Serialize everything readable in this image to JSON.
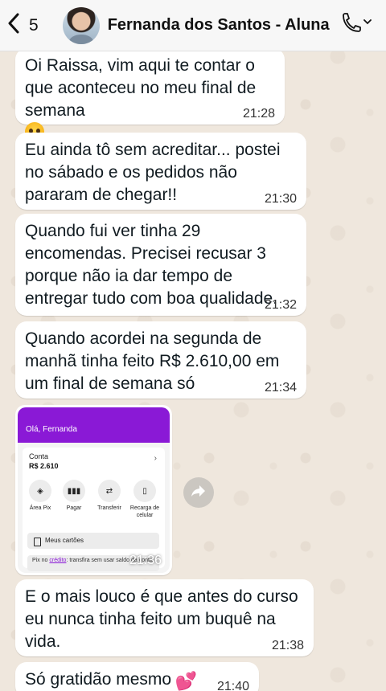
{
  "header": {
    "back_count": "5",
    "contact_name": "Fernanda dos Santos - Aluna"
  },
  "messages": [
    {
      "text": "Oi Raissa, vim aqui te contar o que aconteceu no meu final de semana",
      "emoji": "pleading-face",
      "time": "21:28"
    },
    {
      "text": "Eu ainda tô sem acreditar... postei no sábado e os pedidos não pararam de chegar!!",
      "time": "21:30"
    },
    {
      "text": "Quando fui ver tinha 29 encomendas. Precisei recusar 3 porque não ia dar tempo de entregar tudo com boa qualidade.",
      "time": "21:32"
    },
    {
      "text": "Quando acordei na segunda de manhã tinha feito R$ 2.610,00 em um final de semana só",
      "time": "21:34"
    },
    {
      "text": "E o mais louco é que antes do curso eu nunca tinha feito um buquê na vida.",
      "time": "21:38"
    },
    {
      "text": "Só gratidão mesmo",
      "emoji": "two-hearts",
      "time": "21:40"
    }
  ],
  "image_message": {
    "time": "21:36",
    "screenshot": {
      "greeting": "Olá, Fernanda",
      "account_label": "Conta",
      "balance": "R$ 2.610",
      "actions": [
        "Área Pix",
        "Pagar",
        "Transferir",
        "Recarga de celular"
      ],
      "cards_label": "Meus cartões",
      "pix_prefix": "Pix no",
      "pix_highlight": "crédito",
      "pix_text": ": transfira sem usar saldo da conta"
    }
  },
  "colors": {
    "header_bg": "#f7f7f7",
    "bubble_bg": "#ffffff",
    "bank_purple": "#8a19d6"
  }
}
